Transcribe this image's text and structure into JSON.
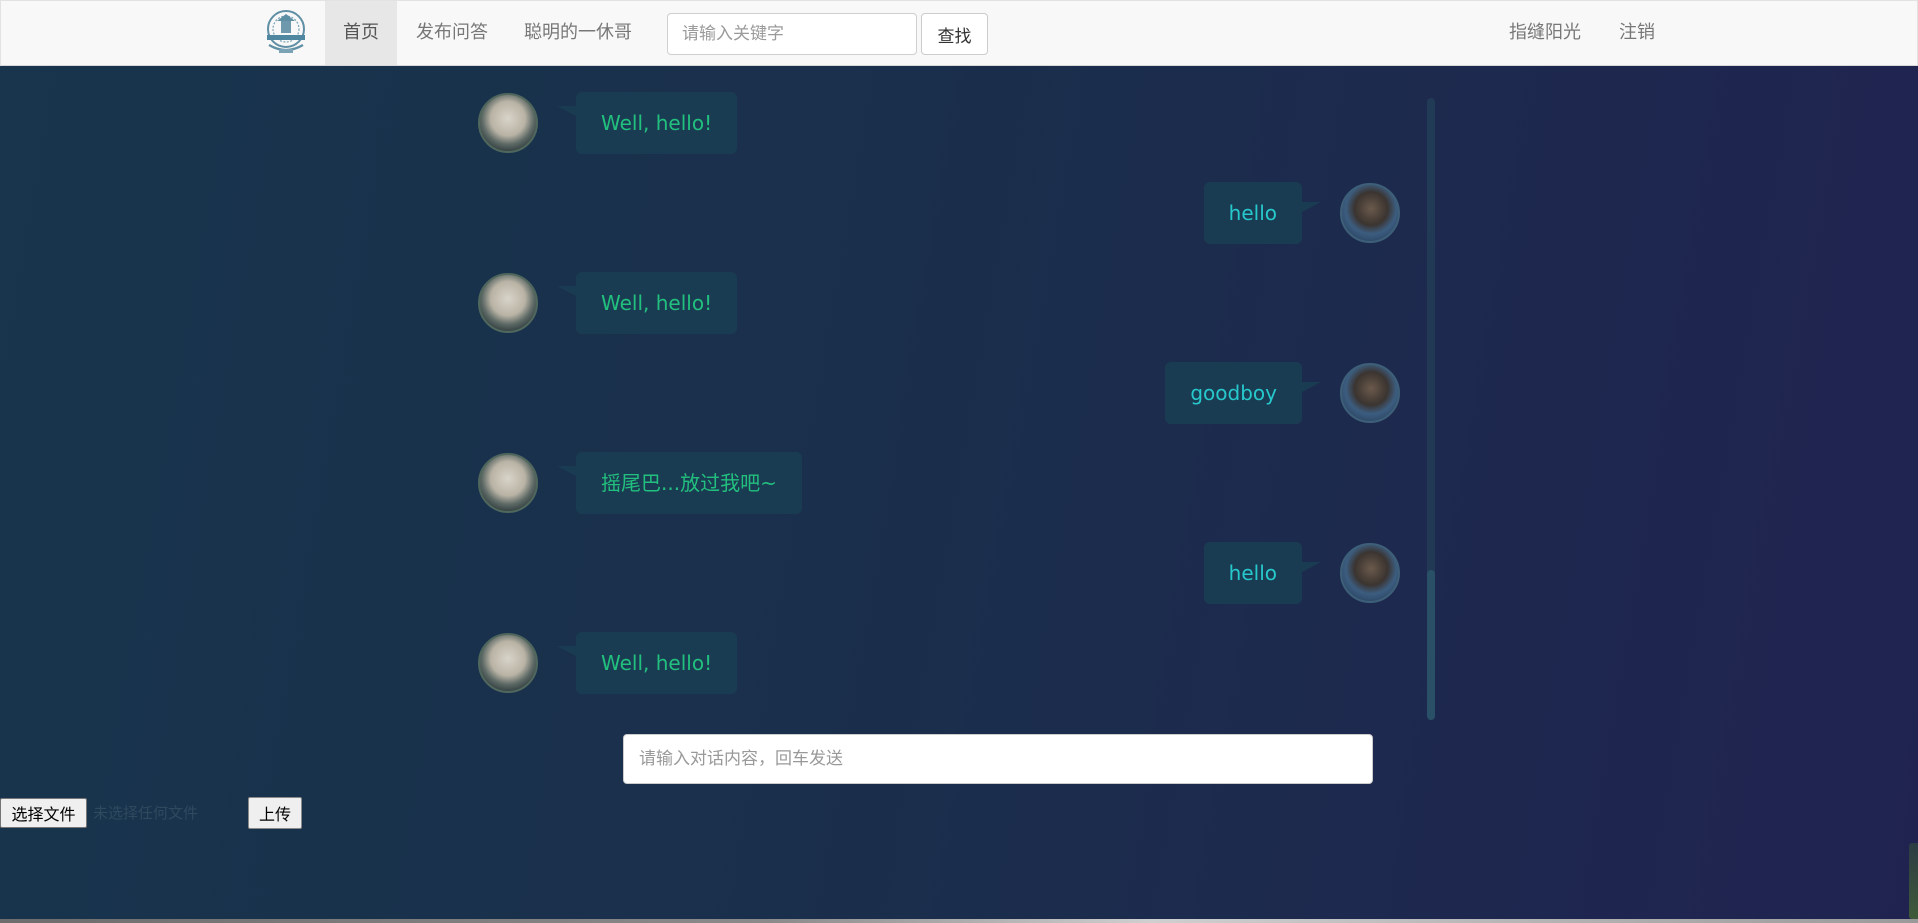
{
  "navbar": {
    "logo_icon": "school-emblem-icon",
    "home": "首页",
    "publish": "发布问答",
    "username": "聪明的一休哥",
    "search_placeholder": "请输入关键字",
    "search_button": "查找",
    "account": "指缝阳光",
    "logout": "注销"
  },
  "chat": {
    "messages": [
      {
        "side": "bot",
        "text": "Well, hello!"
      },
      {
        "side": "user",
        "text": "hello"
      },
      {
        "side": "bot",
        "text": "Well, hello!"
      },
      {
        "side": "user",
        "text": "goodboy"
      },
      {
        "side": "bot",
        "text": "摇尾巴...放过我吧~"
      },
      {
        "side": "user",
        "text": "hello"
      },
      {
        "side": "bot",
        "text": "Well, hello!"
      }
    ],
    "input_placeholder": "请输入对话内容，回车发送"
  },
  "upload": {
    "choose_file": "选择文件",
    "status": "未选择任何文件",
    "upload_button": "上传"
  },
  "colors": {
    "bot_text": "#22c07e",
    "user_text": "#27c8cc",
    "bubble_bg": "#1a3c52"
  }
}
